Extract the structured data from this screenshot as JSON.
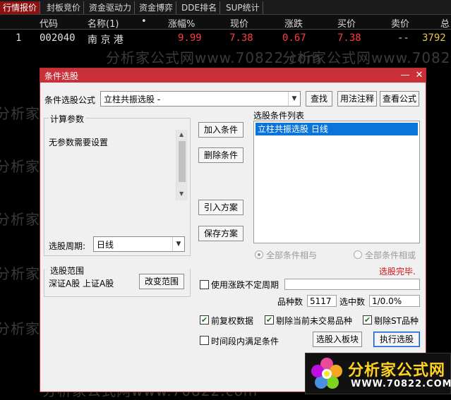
{
  "tabs": [
    "行情报价",
    "封板竞价",
    "资金驱动力",
    "资金博弈",
    "DDE排名",
    "SUP统计"
  ],
  "grid": {
    "headers": [
      "代码",
      "名称(1)",
      "•",
      "涨幅%",
      "现价",
      "涨跌",
      "买价",
      "卖价",
      "总"
    ],
    "row": {
      "index": "1",
      "code": "002040",
      "name": "南 京 港",
      "change_pct": "9.99",
      "price": "7.38",
      "change": "0.67",
      "bid": "7.38",
      "ask": "--",
      "total": "3792"
    }
  },
  "watermark": "分析家公式网www.70822.com",
  "dialog": {
    "title": "条件选股",
    "formula_label": "条件选股公式",
    "formula_value": "立柱共振选股  -",
    "btn_find": "查找",
    "btn_usage": "用法注释",
    "btn_view": "查看公式",
    "params_title": "计算参数",
    "params_text": "无参数需要设置",
    "period_label": "选股周期:",
    "period_value": "日线",
    "btn_add": "加入条件",
    "btn_delete": "删除条件",
    "btn_import": "引入方案",
    "btn_save": "保存方案",
    "list_title": "选股条件列表",
    "list_items": [
      "立柱共振选股  日线"
    ],
    "radio_all_and": "全部条件相与",
    "radio_all_or": "全部条件相或",
    "status": "选股完毕.",
    "range_title": "选股范围",
    "range_text": "深证A股 上证A股",
    "btn_range": "改变范围",
    "use_period": "使用涨跌不定周期",
    "count_label": "品种数",
    "count_value": "5117",
    "hit_label": "选中数",
    "hit_value": "1/0.0%",
    "chk_fq": "前复权数据",
    "chk_excl_untrade": "剔除当前未交易品种",
    "chk_excl_st": "剔除ST品种",
    "chk_time": "时间段内满足条件",
    "btn_to_block": "选股入板块",
    "btn_execute": "执行选股"
  },
  "logo": {
    "name": "分析家公式网",
    "url": "WWW.70822.COM"
  },
  "colors": {
    "title_red": "#c9303a",
    "up_red": "#ff3c3c",
    "list_selected": "#0a74da"
  }
}
